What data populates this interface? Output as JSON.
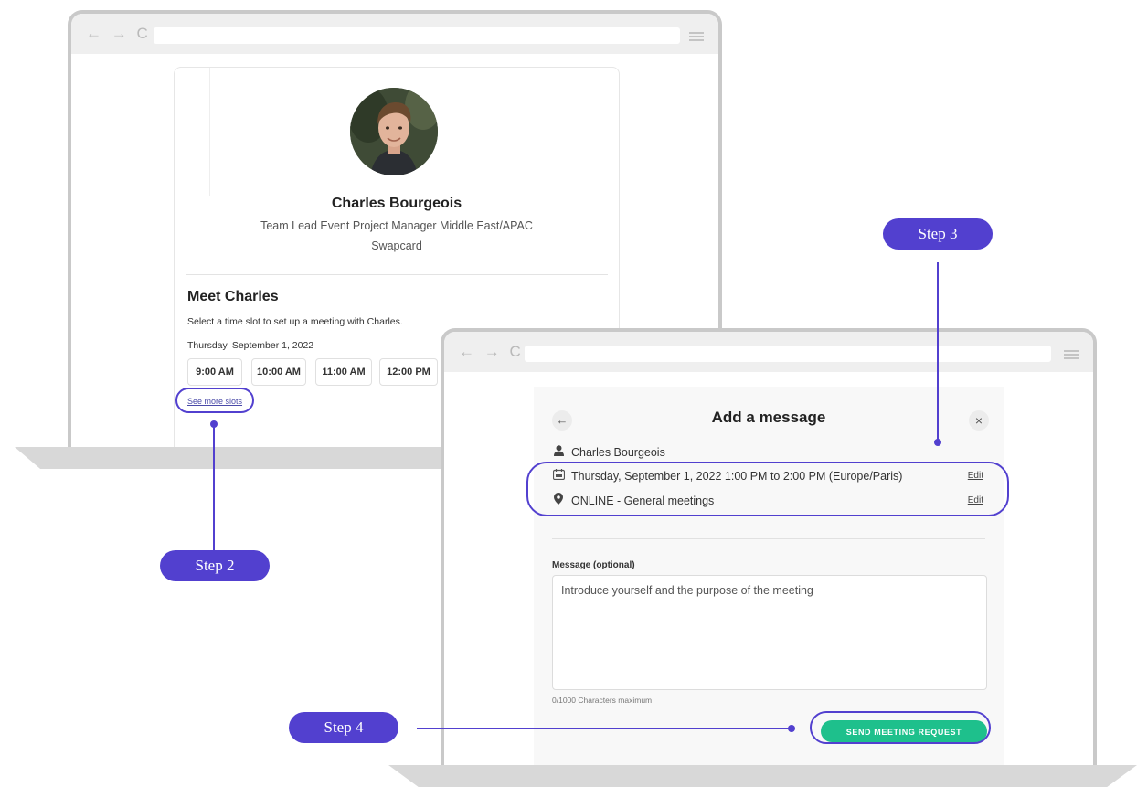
{
  "laptop1": {
    "nav_glyphs": "← → C",
    "profile": {
      "name": "Charles Bourgeois",
      "role": "Team Lead Event Project Manager Middle East/APAC",
      "company": "Swapcard"
    },
    "meet": {
      "title": "Meet Charles",
      "description": "Select a time slot to set up a meeting with Charles.",
      "date": "Thursday, September 1, 2022",
      "slots": [
        "9:00 AM",
        "10:00 AM",
        "11:00 AM",
        "12:00 PM"
      ],
      "see_more": "See more slots"
    }
  },
  "laptop2": {
    "nav_glyphs": "← → C",
    "modal": {
      "back_icon": "←",
      "close_icon": "×",
      "title": "Add a message",
      "attendee": "Charles Bourgeois",
      "datetime": "Thursday, September 1, 2022 1:00 PM to 2:00 PM (Europe/Paris)",
      "location": "ONLINE - General meetings",
      "edit_label": "Edit",
      "message_label": "Message (optional)",
      "message_placeholder": "Introduce yourself and the purpose of the meeting",
      "char_count": "0/1000 Characters maximum",
      "send_label": "SEND MEETING REQUEST"
    }
  },
  "steps": {
    "step2": "Step 2",
    "step3": "Step 3",
    "step4": "Step 4"
  },
  "colors": {
    "accent": "#5240cf",
    "send_button": "#1ec08c"
  }
}
